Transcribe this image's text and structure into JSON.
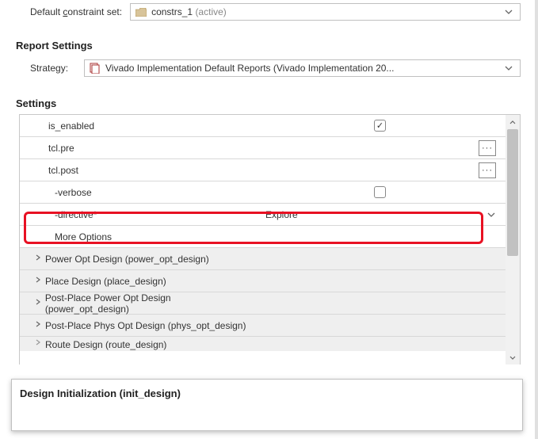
{
  "constraint": {
    "label_pre": "Default ",
    "label_u": "c",
    "label_post": "onstraint set:",
    "value": "constrs_1",
    "status": "(active)"
  },
  "report_section": {
    "title": "Report Settings"
  },
  "strategy": {
    "label": "Strategy:",
    "text": "Vivado Implementation Default Reports (Vivado Implementation 20..."
  },
  "settings_section": {
    "title": "Settings"
  },
  "props": {
    "is_enabled": {
      "name": "is_enabled"
    },
    "tcl_pre": {
      "name": "tcl.pre"
    },
    "tcl_post": {
      "name": "tcl.post"
    },
    "verbose": {
      "name": "-verbose"
    },
    "directive": {
      "name": "-directive*",
      "value": "Explore"
    },
    "more_options": {
      "name": "More Options"
    }
  },
  "categories": [
    "Power Opt Design (power_opt_design)",
    "Place Design (place_design)",
    "Post-Place Power Opt Design (power_opt_design)",
    "Post-Place Phys Opt Design (phys_opt_design)",
    "Route Design (route_design)"
  ],
  "tooltip": {
    "title": "Design Initialization (init_design)"
  },
  "icons": {
    "check": "✓",
    "browse": "···"
  }
}
